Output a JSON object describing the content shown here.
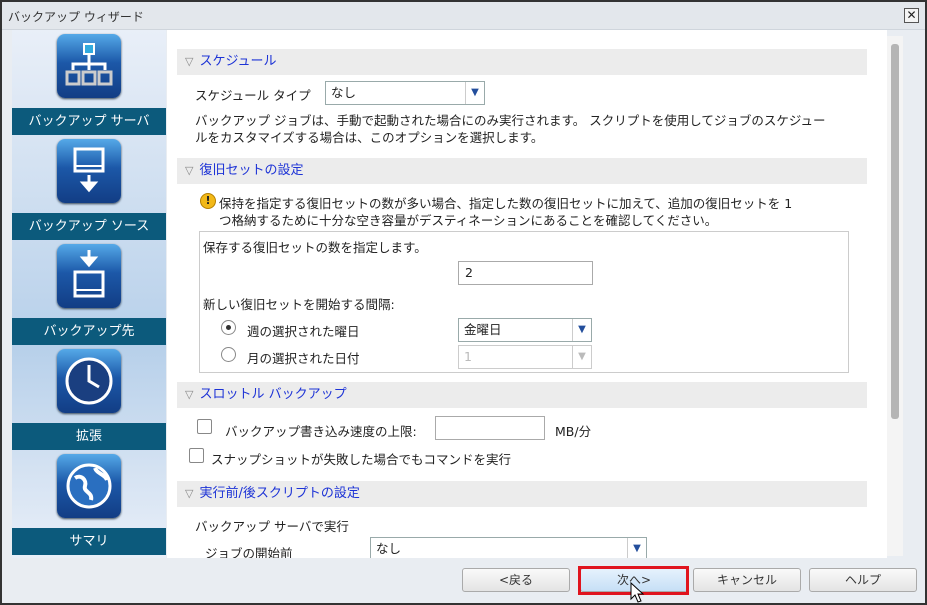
{
  "window": {
    "title": "バックアップ ウィザード",
    "close": "✕"
  },
  "sidebar": {
    "items": [
      {
        "label": "バックアップ サーバ",
        "icon": "server-hierarchy-icon"
      },
      {
        "label": "バックアップ ソース",
        "icon": "drive-download-icon"
      },
      {
        "label": "バックアップ先",
        "icon": "drive-destination-icon"
      },
      {
        "label": "拡張",
        "icon": "clock-icon"
      },
      {
        "label": "サマリ",
        "icon": "globe-icon"
      }
    ]
  },
  "schedule": {
    "header": "スケジュール",
    "type_label": "スケジュール タイプ",
    "type_value": "なし",
    "desc1": "バックアップ ジョブは、手動で起動された場合にのみ実行されます。 スクリプトを使用してジョブのスケジュー",
    "desc2": "ルをカスタマイズする場合は、このオプションを選択します。"
  },
  "recovery": {
    "header": "復旧セットの設定",
    "warn1": "保持を指定する復旧セットの数が多い場合、指定した数の復旧セットに加えて、追加の復旧セットを 1",
    "warn2": "つ格納するために十分な空き容量がデスティネーションにあることを確認してください。",
    "count_label": "保存する復旧セットの数を指定します。",
    "count_value": "2",
    "interval_label": "新しい復旧セットを開始する間隔:",
    "weekday_label": "週の選択された曜日",
    "weekday_value": "金曜日",
    "monthday_label": "月の選択された日付",
    "monthday_value": "1"
  },
  "throttle": {
    "header": "スロットル バックアップ",
    "limit_label": "バックアップ書き込み速度の上限:",
    "limit_value": "",
    "unit": "MB/分",
    "snapshot_label": "スナップショットが失敗した場合でもコマンドを実行"
  },
  "scripts": {
    "header": "実行前/後スクリプトの設定",
    "run_on": "バックアップ サーバで実行",
    "before_label": "ジョブの開始前",
    "before_value": "なし"
  },
  "buttons": {
    "back": "<戻る",
    "next": "次へ>",
    "cancel": "キャンセル",
    "help": "ヘルプ"
  }
}
